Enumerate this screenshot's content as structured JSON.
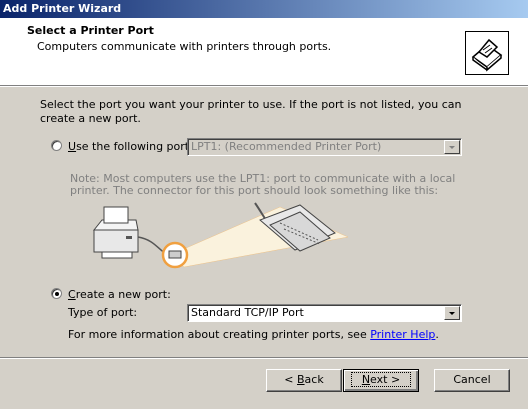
{
  "window": {
    "title": "Add Printer Wizard"
  },
  "header": {
    "title": "Select a Printer Port",
    "subtitle": "Computers communicate with printers through ports.",
    "icon": "printer-wizard-icon"
  },
  "body": {
    "instruction": "Select the port you want your printer to use.  If the port is not listed, you can create a new port.",
    "use_port": {
      "label_accel": "U",
      "label_rest": "se the following port:",
      "selected": false,
      "value": "LPT1: (Recommended Printer Port)",
      "disabled": true
    },
    "note": "Note: Most computers use the LPT1: port to communicate with a local printer. The connector for this port should look something like this:",
    "create_port": {
      "label_accel": "C",
      "label_rest": "reate a new port:",
      "selected": true,
      "type_label": "Type of port:",
      "type_value": "Standard TCP/IP Port"
    },
    "more_info_text": "For more information about creating printer ports, see ",
    "help_link": "Printer Help",
    "more_info_end": "."
  },
  "buttons": {
    "back_prefix": "< ",
    "back_accel": "B",
    "back_rest": "ack",
    "next_accel": "N",
    "next_rest": "ext >",
    "cancel": "Cancel"
  }
}
